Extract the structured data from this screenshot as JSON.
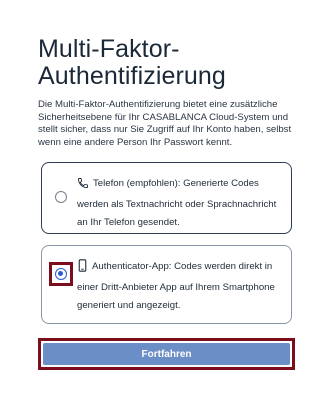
{
  "page": {
    "title": "Multi-Faktor-Authentifizierung",
    "description": "Die Multi-Faktor-Authentifizierung bietet eine zusätzliche Sicherheitsebene für Ihr CASABLANCA Cloud-System und stellt sicher, dass nur Sie Zugriff auf Ihr Konto haben, selbst wenn eine andere Person Ihr Passwort kennt."
  },
  "options": [
    {
      "icon": "phone-icon",
      "label": "Telefon (empfohlen): Generierte Codes werden als Textnachricht oder Sprachnachricht an Ihr Telefon gesendet.",
      "selected": false
    },
    {
      "icon": "smartphone-icon",
      "label": "Authenticator-App: Codes werden direkt in einer Dritt-Anbieter App auf Ihrem Smartphone generiert und angezeigt.",
      "selected": true
    }
  ],
  "submit": {
    "label": "Fortfahren"
  },
  "colors": {
    "accent": "#6b8ec6",
    "highlight": "#7a0e1c",
    "radio_selected": "#2a5bd0"
  }
}
